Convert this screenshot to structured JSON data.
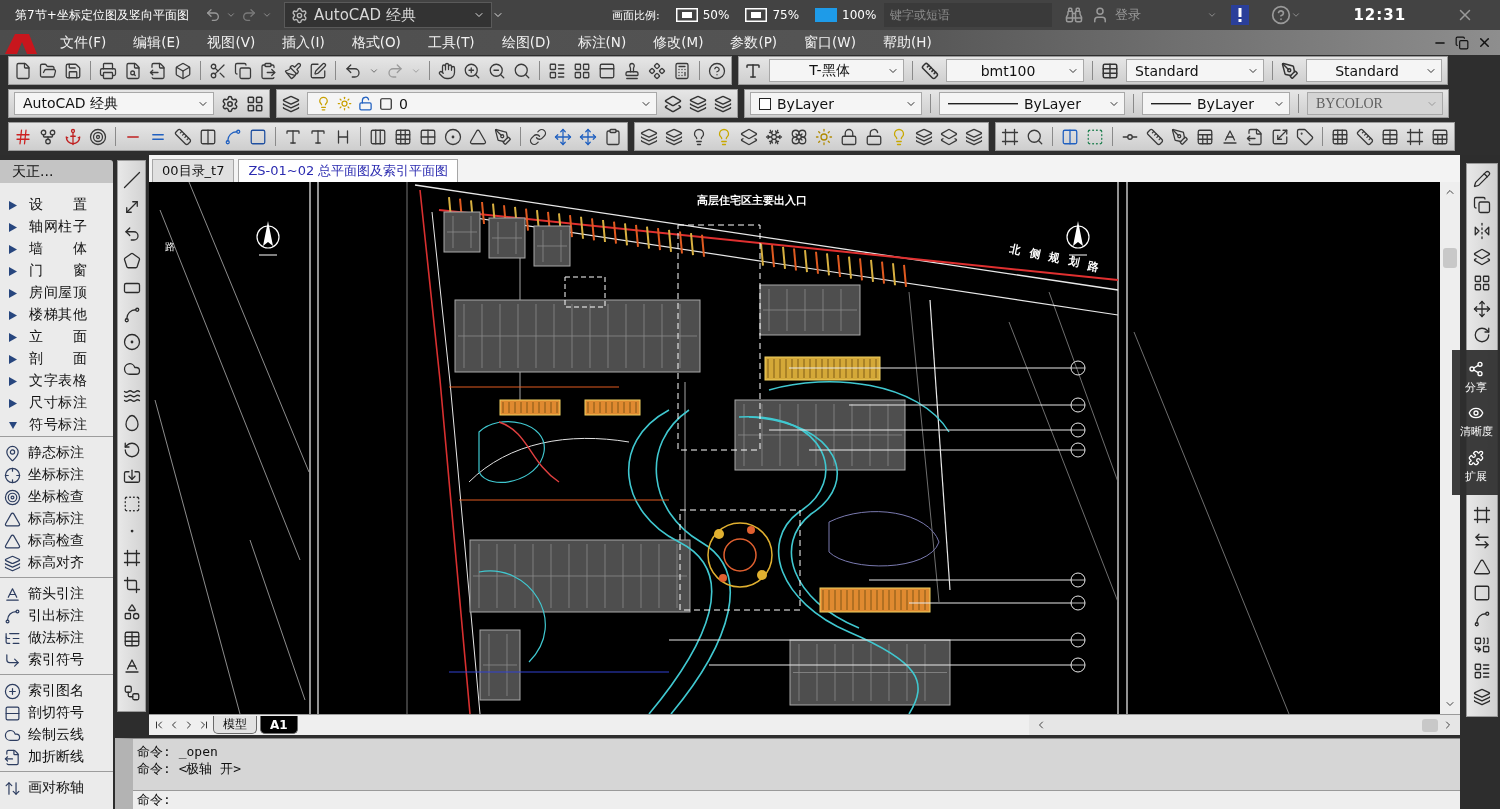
{
  "player": {
    "title": "第7节+坐标定位图及竖向平面图",
    "ratio_label": "画面比例:",
    "ratios": [
      {
        "label": "50%",
        "selected": false
      },
      {
        "label": "75%",
        "selected": false
      },
      {
        "label": "100%",
        "selected": true
      }
    ],
    "clock": "12:31",
    "side_buttons": [
      "分享",
      "清晰度",
      "扩展"
    ]
  },
  "title_bar": {
    "workspace": "AutoCAD 经典",
    "search": {
      "placeholder": "键字或短语"
    },
    "sign_in": "登录"
  },
  "menu_bar": [
    "文件(F)",
    "编辑(E)",
    "视图(V)",
    "插入(I)",
    "格式(O)",
    "工具(T)",
    "绘图(D)",
    "标注(N)",
    "修改(M)",
    "参数(P)",
    "窗口(W)",
    "帮助(H)"
  ],
  "styles_toolbar": {
    "text_style": "T-黑体",
    "dimension_style": "bmt100",
    "table_style": "Standard",
    "multileader_style": "Standard"
  },
  "properties_toolbar": {
    "workspace": "AutoCAD 经典",
    "layer": "0",
    "color_control": "ByLayer",
    "linetype": "ByLayer",
    "lineweight": "ByLayer",
    "plot_style": {
      "value": "BYCOLOR",
      "disabled": true
    }
  },
  "tianzheng_menu": {
    "title": "天正...",
    "categories": [
      {
        "label": "设 置",
        "expanded": false
      },
      {
        "label": "轴网柱子",
        "expanded": false
      },
      {
        "label": "墙 体",
        "expanded": false
      },
      {
        "label": "门 窗",
        "expanded": false
      },
      {
        "label": "房间屋顶",
        "expanded": false
      },
      {
        "label": "楼梯其他",
        "expanded": false
      },
      {
        "label": "立 面",
        "expanded": false
      },
      {
        "label": "剖 面",
        "expanded": false
      },
      {
        "label": "文字表格",
        "expanded": false
      },
      {
        "label": "尺寸标注",
        "expanded": false
      },
      {
        "label": "符号标注",
        "expanded": true,
        "children": [
          {
            "items": [
              "静态标注",
              "坐标标注",
              "坐标检查",
              "标高标注",
              "标高检查",
              "标高对齐"
            ]
          },
          {
            "items": [
              "箭头引注",
              "引出标注",
              "做法标注",
              "索引符号"
            ]
          },
          {
            "items": [
              "索引图名",
              "剖切符号",
              "绘制云线",
              "加折断线"
            ]
          },
          {
            "items": [
              "画对称轴"
            ]
          }
        ]
      }
    ]
  },
  "drawing_tabs": [
    {
      "label": "00目录_t7",
      "selected": false
    },
    {
      "label": "ZS-01~02 总平面图及索引平面图",
      "selected": true
    }
  ],
  "canvas": {
    "labels": [
      "高层住宅区主要出入口",
      "北侧规划路",
      "路"
    ]
  },
  "layout_tabs": [
    {
      "label": "模型",
      "selected": false
    },
    {
      "label": "A1",
      "selected": true
    }
  ],
  "command_line": {
    "history": [
      "命令: _open",
      "命令: <极轴 开>"
    ],
    "prompt": "命令:"
  }
}
